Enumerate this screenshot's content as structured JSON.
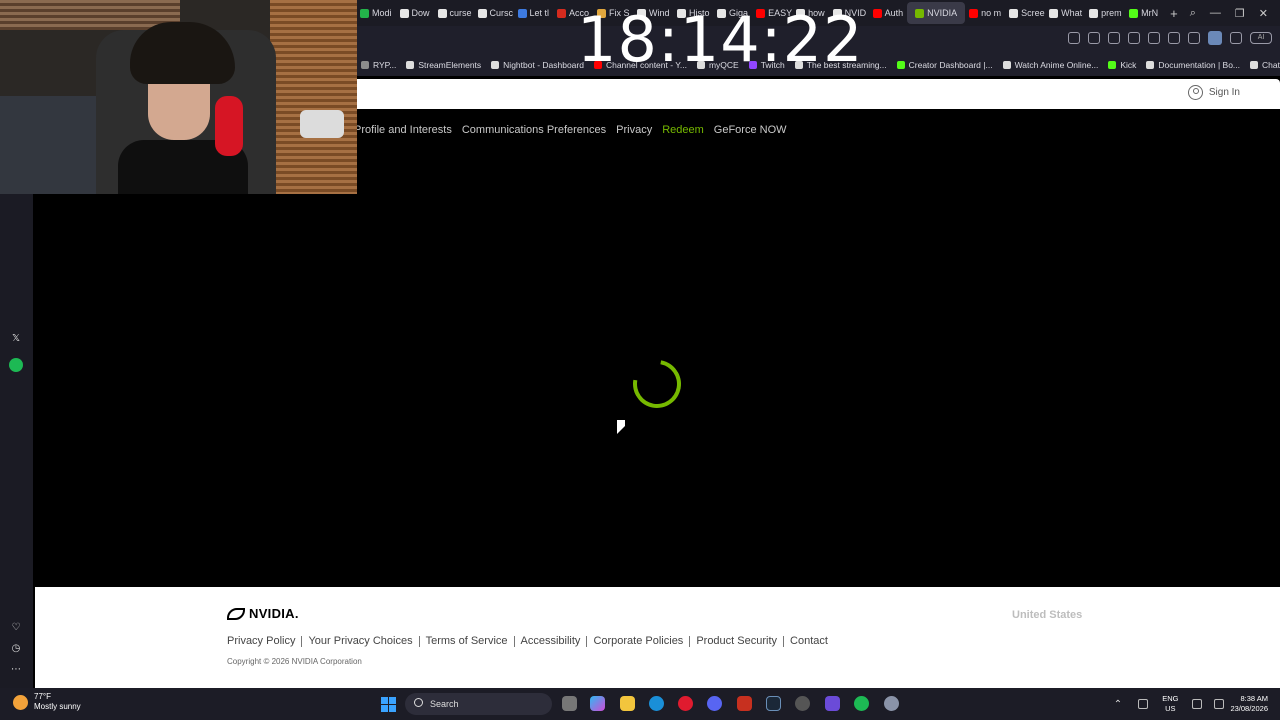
{
  "clock": "18:14:22",
  "browser": {
    "tabs": [
      {
        "label": "Modi",
        "color": "#23b34a"
      },
      {
        "label": "Dow",
        "color": "#e6e6e6"
      },
      {
        "label": "curse",
        "color": "#e6e6e6"
      },
      {
        "label": "Cursc",
        "color": "#e6e6e6"
      },
      {
        "label": "Let tl",
        "color": "#3d7ae0"
      },
      {
        "label": "Acco",
        "color": "#d52b1e"
      },
      {
        "label": "Fix S",
        "color": "#e0a63d"
      },
      {
        "label": "Wind",
        "color": "#e6e6e6"
      },
      {
        "label": "Histo",
        "color": "#e6e6e6"
      },
      {
        "label": "Giga",
        "color": "#e6e6e6"
      },
      {
        "label": "EASY",
        "color": "#ff0000"
      },
      {
        "label": "how",
        "color": "#e6e6e6"
      },
      {
        "label": "NVID",
        "color": "#e6e6e6"
      },
      {
        "label": "Auth",
        "color": "#ff0000"
      },
      {
        "label": "NVIDIA",
        "color": "#76b900",
        "active": true
      },
      {
        "label": "no m",
        "color": "#ff0000"
      },
      {
        "label": "Scree",
        "color": "#e6e6e6"
      },
      {
        "label": "What",
        "color": "#e6e6e6"
      },
      {
        "label": "prem",
        "color": "#e6e6e6"
      },
      {
        "label": "MrN",
        "color": "#53fc18"
      }
    ],
    "bookmarks": [
      {
        "label": "RYP...",
        "color": "#8c8c8c"
      },
      {
        "label": "StreamElements",
        "color": "#dddddd"
      },
      {
        "label": "Nightbot - Dashboard",
        "color": "#dddddd"
      },
      {
        "label": "Channel content - Y...",
        "color": "#ff0000"
      },
      {
        "label": "myQCE",
        "color": "#dddddd"
      },
      {
        "label": "Twitch",
        "color": "#9146ff"
      },
      {
        "label": "The best streaming...",
        "color": "#dddddd"
      },
      {
        "label": "Creator Dashboard |...",
        "color": "#53fc18"
      },
      {
        "label": "Watch Anime Online...",
        "color": "#dddddd"
      },
      {
        "label": "Kick",
        "color": "#53fc18"
      },
      {
        "label": "Documentation | Bo...",
        "color": "#dddddd"
      },
      {
        "label": "ChatGPT",
        "color": "#dddddd"
      }
    ],
    "ai_label": "AI"
  },
  "page": {
    "sign_in": "Sign In",
    "subnav": [
      "Profile and Interests",
      "Communications Preferences",
      "Privacy",
      "Redeem",
      "GeForce NOW"
    ],
    "active_subnav": "Redeem",
    "accent": "#76b900",
    "loading": true
  },
  "footer": {
    "brand": "NVIDIA.",
    "region": "United States",
    "links": [
      "Privacy Policy",
      "Your Privacy Choices",
      "Terms of Service",
      "Accessibility",
      "Corporate Policies",
      "Product Security",
      "Contact"
    ],
    "copyright": "Copyright © 2026 NVIDIA Corporation"
  },
  "taskbar": {
    "weather_temp": "77°F",
    "weather_desc": "Mostly sunny",
    "search_label": "Search",
    "lang": "ENG",
    "region": "US",
    "time": "8:38 AM",
    "date": "23/08/2026"
  }
}
